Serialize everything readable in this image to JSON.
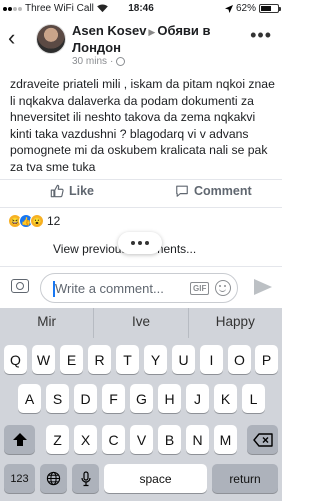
{
  "status_bar": {
    "carrier": "Three WiFi Call",
    "time": "18:46",
    "battery": "62%",
    "battery_level": 0.62
  },
  "header": {
    "author": "Asen Kosev",
    "group": "Обяви в Лондон",
    "timestamp": "30 mins"
  },
  "post": {
    "text": "zdraveite priateli mili , iskam da pitam nqkoi znae li nqkakva dalaverka da podam dokumenti za hneversitet ili neshto takova da zema nqkakvi kinti taka vazdushni ? blagodarq vi v advans pomognete mi da oskubem kralicata nali se pak za tva sme tuka"
  },
  "actions": {
    "like_label": "Like",
    "comment_label": "Comment"
  },
  "reactions": {
    "count": "12",
    "types": [
      "haha-icon",
      "like-icon",
      "wow-icon"
    ]
  },
  "comments": {
    "view_previous": "View previous comments..."
  },
  "composer": {
    "placeholder": "Write a comment...",
    "gif_label": "GIF"
  },
  "keyboard": {
    "suggestions": [
      "Mir",
      "Ive",
      "Happy"
    ],
    "row1": [
      "Q",
      "W",
      "E",
      "R",
      "T",
      "Y",
      "U",
      "I",
      "O",
      "P"
    ],
    "row2": [
      "A",
      "S",
      "D",
      "F",
      "G",
      "H",
      "J",
      "K",
      "L"
    ],
    "row3": [
      "Z",
      "X",
      "C",
      "V",
      "B",
      "N",
      "M"
    ],
    "numbers_label": "123",
    "space_label": "space",
    "return_label": "return"
  },
  "colors": {
    "accent": "#1877f2",
    "text": "#1c1e21",
    "muted": "#606770",
    "keyboard_bg": "#d1d4da"
  }
}
